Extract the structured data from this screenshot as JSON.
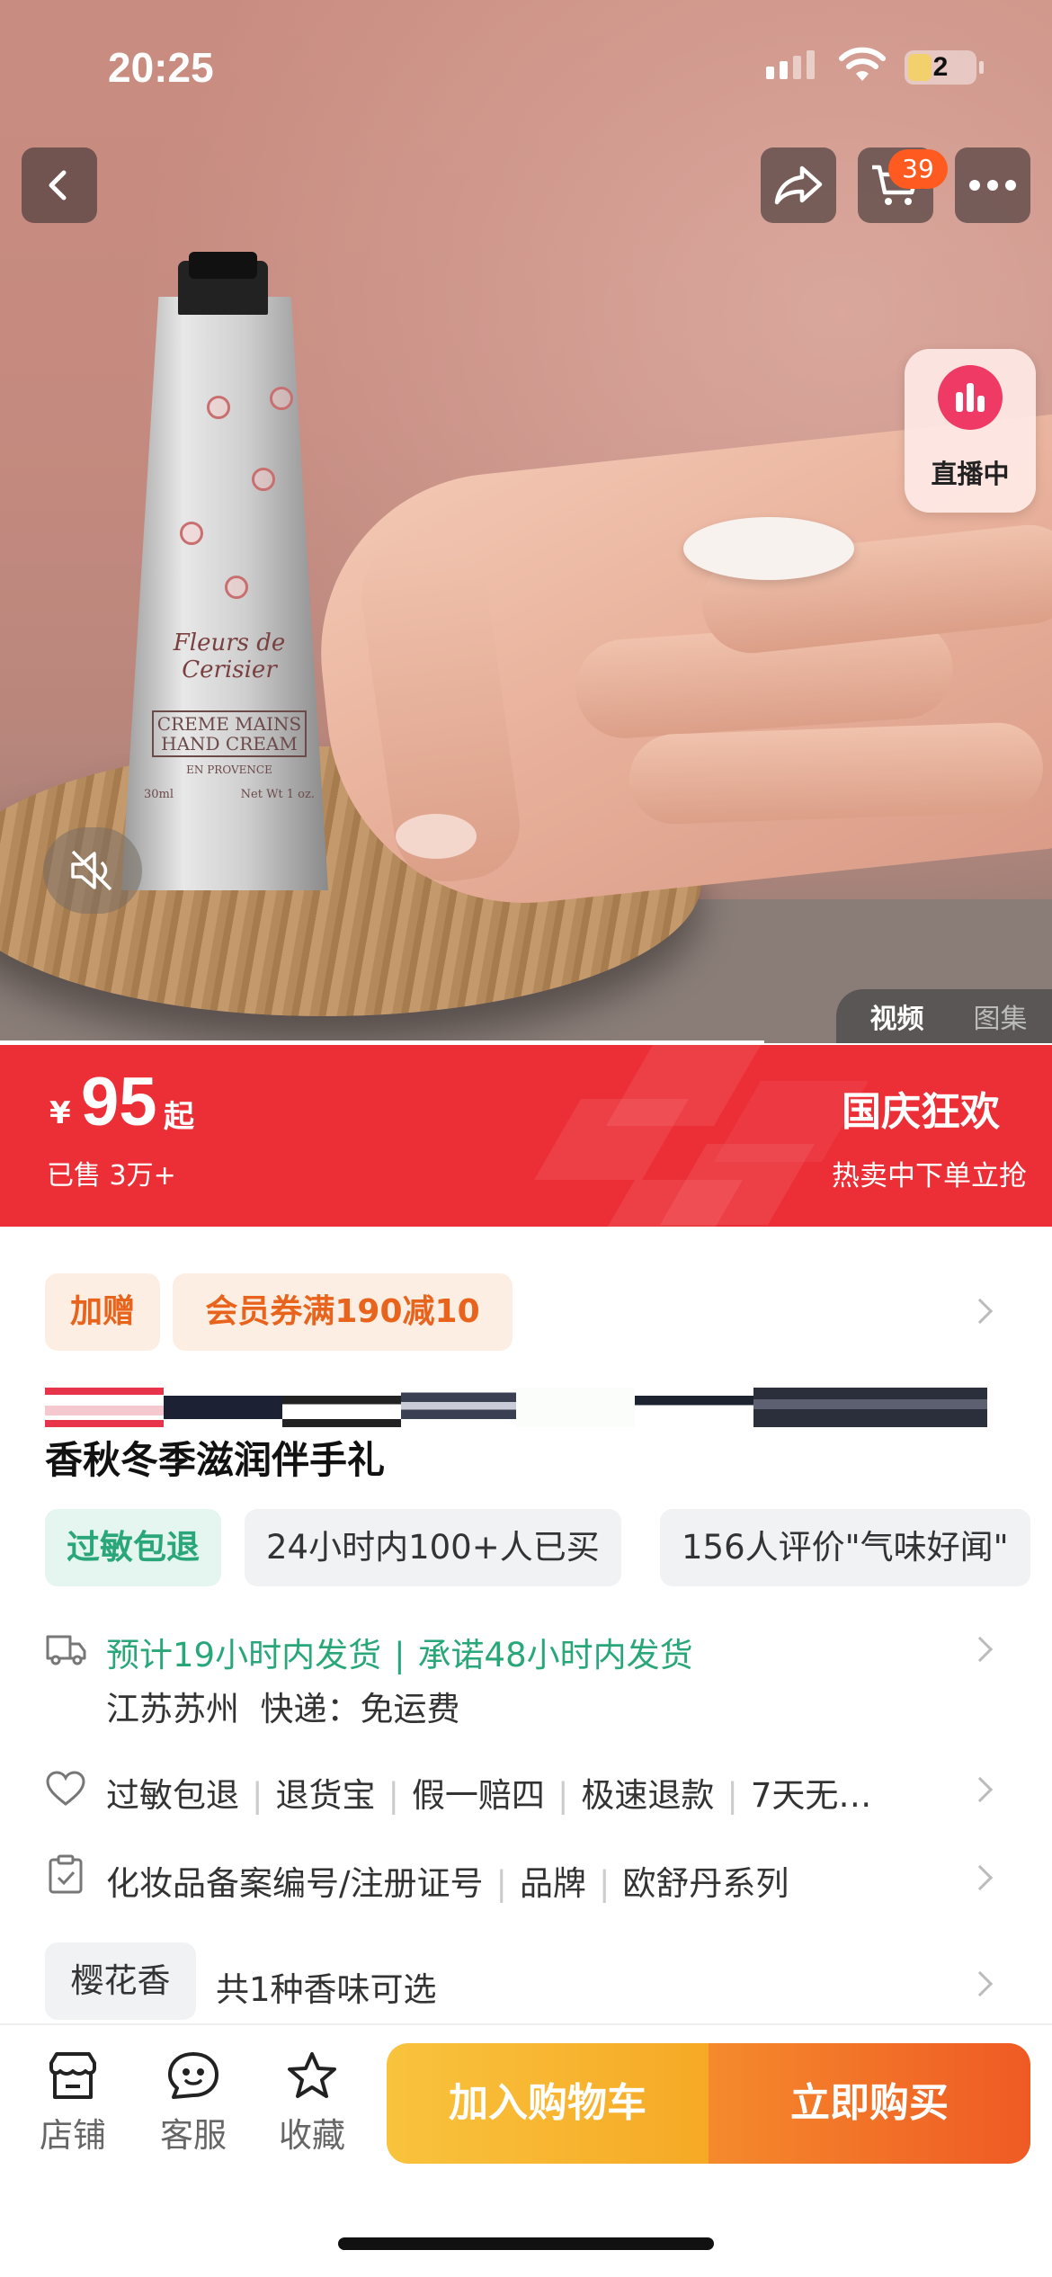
{
  "status_bar": {
    "time": "20:25",
    "battery": "2"
  },
  "nav": {
    "cart_count": "39"
  },
  "live": {
    "label": "直播中"
  },
  "media": {
    "tab_video": "视频",
    "tab_gallery": "图集",
    "product_label_lines": [
      "Fleurs de Cerisier",
      "CREME MAINS",
      "HAND CREAM",
      "EN PROVENCE"
    ],
    "tube_size_left": "30ml",
    "tube_size_right": "Net Wt 1 oz."
  },
  "price_bar": {
    "currency": "¥",
    "price": "95",
    "price_suffix": "起",
    "sold": "已售 3万+",
    "promo_title": "国庆狂欢",
    "promo_sub": "热卖中下单立抢"
  },
  "tags": {
    "gift": "加赠",
    "coupon": "会员券满190减10"
  },
  "product": {
    "title": "香秋冬季滋润伴手礼"
  },
  "highlights": [
    "过敏包退",
    "24小时内100+人已买",
    "156人评价\"气味好闻\""
  ],
  "shipping": {
    "estimate": "预计19小时内发货",
    "promise": "承诺48小时内发货",
    "origin": "江苏苏州",
    "delivery": "快递：免运费"
  },
  "services": [
    "过敏包退",
    "退货宝",
    "假一赔四",
    "极速退款",
    "7天无…"
  ],
  "params": [
    "化妆品备案编号/注册证号",
    "品牌",
    "欧舒丹系列"
  ],
  "scent": {
    "selected": "樱花香",
    "options_text": "共1种香味可选"
  },
  "bottom_bar": {
    "shop": "店铺",
    "service": "客服",
    "favorite": "收藏",
    "add_cart": "加入购物车",
    "buy_now": "立即购买"
  },
  "colors": {
    "price_red": "#ec2f37",
    "accent_orange": "#e8641c",
    "green": "#2aa77a",
    "cart_yellow": "#f6a925",
    "buy_orange": "#ef5a24"
  }
}
